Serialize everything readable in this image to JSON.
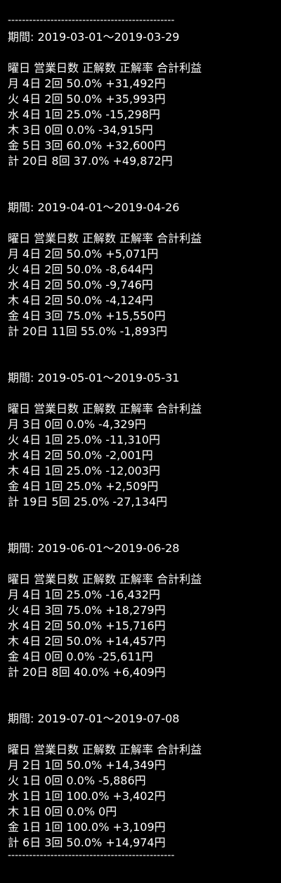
{
  "divider": "-----------------------------------------------",
  "header_cols": [
    "曜日",
    "営業日数",
    "正解数",
    "正解率",
    "合計利益"
  ],
  "period_label": "期間:",
  "sections": [
    {
      "period": "2019-03-01〜2019-03-29",
      "rows": [
        [
          "月",
          "4日",
          "2回",
          "50.0%",
          "+31,492円"
        ],
        [
          "火",
          "4日",
          "2回",
          "50.0%",
          "+35,993円"
        ],
        [
          "水",
          "4日",
          "1回",
          "25.0%",
          "-15,298円"
        ],
        [
          "木",
          "3日",
          "0回",
          "0.0%",
          "-34,915円"
        ],
        [
          "金",
          "5日",
          "3回",
          "60.0%",
          "+32,600円"
        ],
        [
          "計",
          "20日",
          "8回",
          "37.0%",
          "+49,872円"
        ]
      ]
    },
    {
      "period": "2019-04-01〜2019-04-26",
      "rows": [
        [
          "月",
          "4日",
          "2回",
          "50.0%",
          "+5,071円"
        ],
        [
          "火",
          "4日",
          "2回",
          "50.0%",
          "-8,644円"
        ],
        [
          "水",
          "4日",
          "2回",
          "50.0%",
          "-9,746円"
        ],
        [
          "木",
          "4日",
          "2回",
          "50.0%",
          "-4,124円"
        ],
        [
          "金",
          "4日",
          "3回",
          "75.0%",
          "+15,550円"
        ],
        [
          "計",
          "20日",
          "11回",
          "55.0%",
          "-1,893円"
        ]
      ]
    },
    {
      "period": "2019-05-01〜2019-05-31",
      "rows": [
        [
          "月",
          "3日",
          "0回",
          "0.0%",
          "-4,329円"
        ],
        [
          "火",
          "4日",
          "1回",
          "25.0%",
          "-11,310円"
        ],
        [
          "水",
          "4日",
          "2回",
          "50.0%",
          "-2,001円"
        ],
        [
          "木",
          "4日",
          "1回",
          "25.0%",
          "-12,003円"
        ],
        [
          "金",
          "4日",
          "1回",
          "25.0%",
          "+2,509円"
        ],
        [
          "計",
          "19日",
          "5回",
          "25.0%",
          "-27,134円"
        ]
      ]
    },
    {
      "period": "2019-06-01〜2019-06-28",
      "rows": [
        [
          "月",
          "4日",
          "1回",
          "25.0%",
          "-16,432円"
        ],
        [
          "火",
          "4日",
          "3回",
          "75.0%",
          "+18,279円"
        ],
        [
          "水",
          "4日",
          "2回",
          "50.0%",
          "+15,716円"
        ],
        [
          "木",
          "4日",
          "2回",
          "50.0%",
          "+14,457円"
        ],
        [
          "金",
          "4日",
          "0回",
          "0.0%",
          "-25,611円"
        ],
        [
          "計",
          "20日",
          "8回",
          "40.0%",
          "+6,409円"
        ]
      ]
    },
    {
      "period": "2019-07-01〜2019-07-08",
      "rows": [
        [
          "月",
          "2日",
          "1回",
          "50.0%",
          "+14,349円"
        ],
        [
          "火",
          "1日",
          "0回",
          "0.0%",
          "-5,886円"
        ],
        [
          "水",
          "1日",
          "1回",
          "100.0%",
          "+3,402円"
        ],
        [
          "木",
          "1日",
          "0回",
          "0.0%",
          "0円"
        ],
        [
          "金",
          "1日",
          "1回",
          "100.0%",
          "+3,109円"
        ],
        [
          "計",
          "6日",
          "3回",
          "50.0%",
          "+14,974円"
        ]
      ]
    }
  ]
}
